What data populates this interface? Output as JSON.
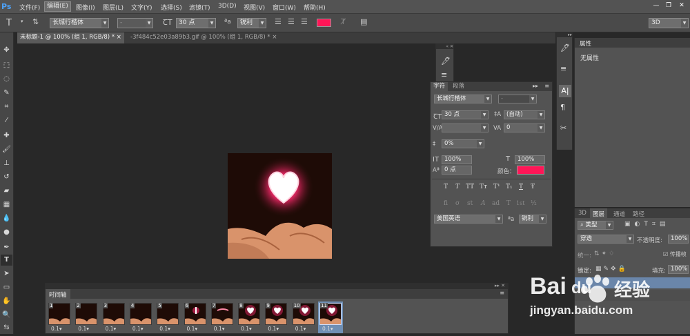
{
  "app": {
    "logo": "Ps"
  },
  "menu": [
    "文件(F)",
    "编辑(E)",
    "图像(I)",
    "图层(L)",
    "文字(Y)",
    "选择(S)",
    "滤镜(T)",
    "3D(D)",
    "视图(V)",
    "窗口(W)",
    "帮助(H)"
  ],
  "workspace": "3D",
  "options": {
    "tool_glyph": "T",
    "font_family": "长城行楷体",
    "font_style": "-",
    "font_size": "30 点",
    "aa_label": "ªa",
    "antialias": "锐利",
    "color": "#ff1657"
  },
  "tabs": [
    {
      "label": "未标题-1 @ 100% (组 1, RGB/8) *"
    },
    {
      "label": "-3f484c52e03a89b3.gif @ 100% (组 1, RGB/8) *"
    }
  ],
  "char_panel": {
    "tab_char": "字符",
    "tab_para": "段落",
    "font_family": "长城行楷体",
    "font_style": "-",
    "size": "30 点",
    "leading": "(自动)",
    "kerning": "",
    "tracking": "0",
    "tsume": "0%",
    "vscale": "100%",
    "hscale": "100%",
    "baseline": "0 点",
    "color_label": "颜色：",
    "color": "#ff1657",
    "style_buttons": [
      "T",
      "T",
      "TT",
      "Tт",
      "T¹",
      "T₁",
      "T",
      "Ŧ"
    ],
    "ot_buttons": [
      "fi",
      "σ",
      "st",
      "A",
      "ad",
      "T",
      "1st",
      "½"
    ],
    "language": "美国英语",
    "aa_label": "ªa",
    "antialias": "锐利"
  },
  "properties": {
    "title": "属性",
    "content": "无属性"
  },
  "layers": {
    "tabs": [
      "3D",
      "图层",
      "通道",
      "路径"
    ],
    "filter": "类型",
    "blend": "穿透",
    "opacity_label": "不透明度:",
    "opacity": "100%",
    "lock_label": "锁定:",
    "fill_label": "填充:",
    "fill": "100%",
    "unify_label": "统一:",
    "propagate": "传播帧"
  },
  "timeline": {
    "title": "时间轴",
    "frames": [
      {
        "num": "1",
        "delay": "0.1▾",
        "kind": "hand"
      },
      {
        "num": "2",
        "delay": "0.1▾",
        "kind": "hand"
      },
      {
        "num": "3",
        "delay": "0.1▾",
        "kind": "hand"
      },
      {
        "num": "4",
        "delay": "0.1▾",
        "kind": "hand"
      },
      {
        "num": "5",
        "delay": "0.1▾",
        "kind": "hand"
      },
      {
        "num": "6",
        "delay": "0.1▾",
        "kind": "spark"
      },
      {
        "num": "7",
        "delay": "0.1▾",
        "kind": "line"
      },
      {
        "num": "8",
        "delay": "0.1▾",
        "kind": "heart"
      },
      {
        "num": "9",
        "delay": "0.1▾",
        "kind": "heart"
      },
      {
        "num": "10",
        "delay": "0.1▾",
        "kind": "heart"
      },
      {
        "num": "11",
        "delay": "0.1▾",
        "kind": "heart"
      }
    ]
  },
  "watermark": {
    "brand": "Bai",
    "brand2": "du",
    "text": "经验",
    "url": "jingyan.baidu.com"
  }
}
